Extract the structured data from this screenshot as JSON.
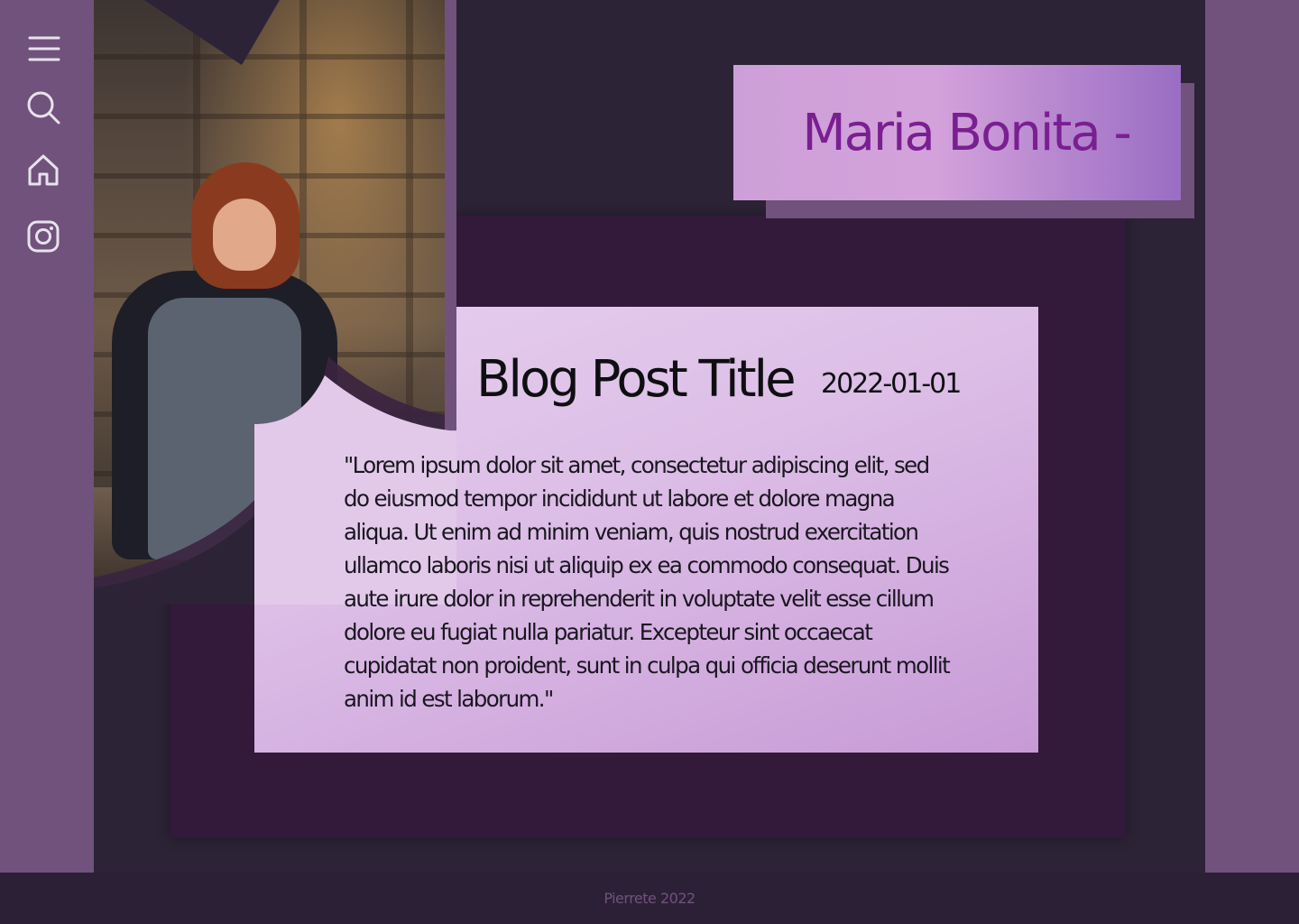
{
  "nav": {
    "items": [
      {
        "icon": "menu-icon"
      },
      {
        "icon": "search-icon"
      },
      {
        "icon": "home-icon"
      },
      {
        "icon": "instagram-icon"
      }
    ]
  },
  "header": {
    "name": "Maria Bonita -"
  },
  "post": {
    "title": "Blog Post Title",
    "date": "2022-01-01",
    "body": "\"Lorem ipsum dolor sit amet, consectetur adipiscing elit, sed do eiusmod tempor incididunt ut labore et dolore magna aliqua. Ut enim ad minim veniam, quis nostrud exercitation ullamco laboris nisi ut aliquip ex ea commodo consequat. Duis aute irure dolor in reprehenderit in voluptate velit esse cillum dolore eu fugiat nulla pariatur. Excepteur sint occaecat cupidatat non proident, sunt in culpa qui officia deserunt mollit anim id est laborum.\""
  },
  "footer": {
    "text": "Pierrete 2022"
  },
  "colors": {
    "sidebar": "#70527c",
    "background": "#2c2336",
    "panel": "#33193a",
    "name_text": "#7a1f91"
  }
}
